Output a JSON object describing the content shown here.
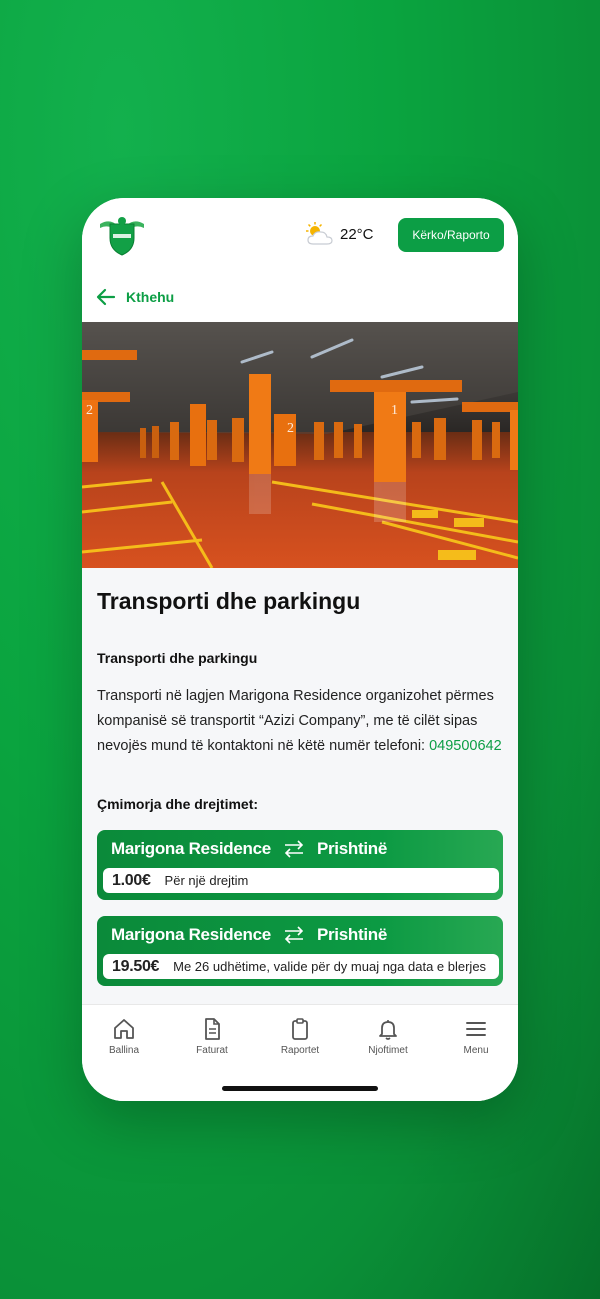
{
  "header": {
    "temperature": "22°C",
    "report_button": "Kërko/Raporto",
    "back_label": "Kthehu"
  },
  "article": {
    "title": "Transporti dhe parkingu",
    "subtitle": "Transporti dhe parkingu",
    "body": "Transporti në lagjen Marigona Residence organizohet përmes kompanisë së transportit “Azizi Company”, me të cilët sipas nevojës mund të kontaktoni në këtë numër telefoni: ",
    "phone": "049500642",
    "prices_label": "Çmimorja dhe drejtimet:"
  },
  "routes": [
    {
      "from": "Marigona Residence",
      "to": "Prishtinë",
      "price": "1.00€",
      "description": "Për një drejtim"
    },
    {
      "from": "Marigona Residence",
      "to": "Prishtinë",
      "price": "19.50€",
      "description": "Me 26 udhëtime, valide për dy muaj nga data e blerjes"
    }
  ],
  "tabs": [
    {
      "label": "Ballina",
      "icon": "home-icon"
    },
    {
      "label": "Faturat",
      "icon": "document-icon"
    },
    {
      "label": "Raportet",
      "icon": "clipboard-icon"
    },
    {
      "label": "Njoftimet",
      "icon": "bell-icon"
    },
    {
      "label": "Menu",
      "icon": "menu-icon"
    }
  ],
  "colors": {
    "brand_green": "#0c9e45",
    "background": "#0aa43f"
  }
}
